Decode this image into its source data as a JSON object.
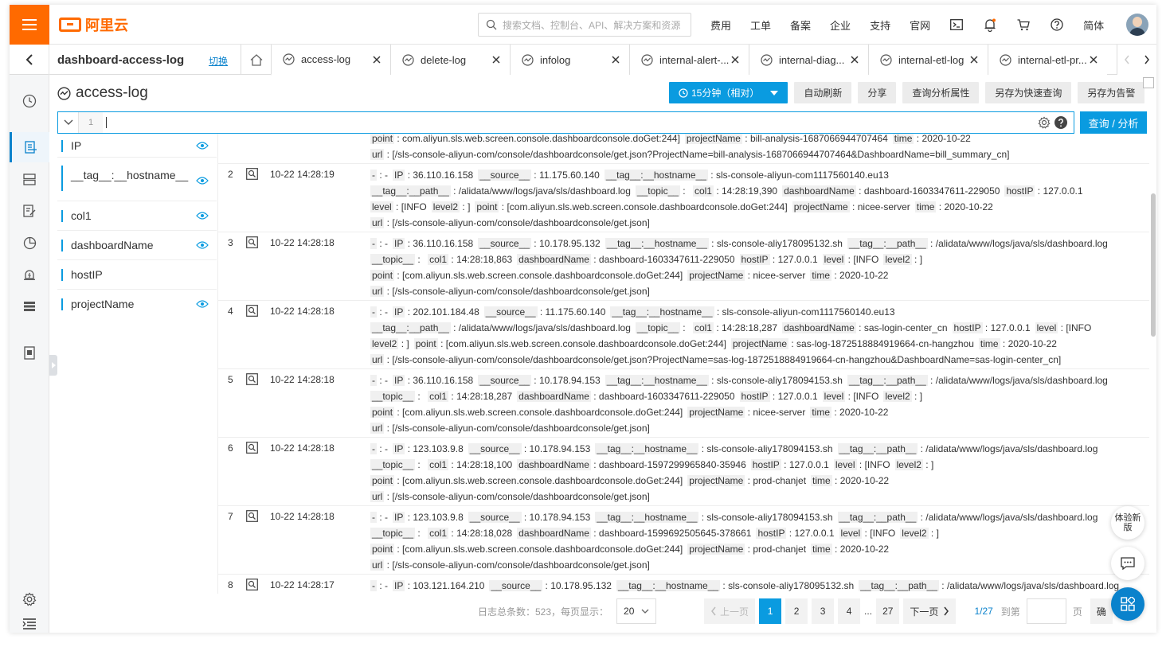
{
  "brand": {
    "name": "阿里云"
  },
  "search": {
    "placeholder": "搜索文档、控制台、API、解决方案和资源"
  },
  "topnav": [
    "费用",
    "工单",
    "备案",
    "企业",
    "支持",
    "官网"
  ],
  "lang": "简体",
  "project": {
    "name": "dashboard-access-log",
    "switch_label": "切换"
  },
  "tabs": [
    {
      "label": "access-log",
      "active": true
    },
    {
      "label": "delete-log"
    },
    {
      "label": "infolog"
    },
    {
      "label": "internal-alert-..."
    },
    {
      "label": "internal-diag..."
    },
    {
      "label": "internal-etl-log"
    },
    {
      "label": "internal-etl-pr..."
    }
  ],
  "query": {
    "title": "access-log",
    "time_label": "15分钟（相对）",
    "buttons": [
      "自动刷新",
      "分享",
      "查询分析属性",
      "另存为快速查询",
      "另存为告警"
    ],
    "line_number": "1",
    "submit_label": "查询 / 分析"
  },
  "fields": [
    "IP",
    "__tag__:__hostname__",
    "col1",
    "dashboardName",
    "hostIP",
    "projectName"
  ],
  "logs": [
    {
      "num": "",
      "time": "",
      "lines": [
        [
          [
            "point",
            "com.aliyun.sls.web.screen.console.dashboardconsole.doGet:244]"
          ],
          [
            "projectName",
            "bill-analysis-1687066944707464"
          ],
          [
            "time",
            "2020-10-22"
          ]
        ],
        [
          [
            "url",
            "[/sls-console-aliyun-com/console/dashboardconsole/get.json?ProjectName=bill-analysis-1687066944707464&DashboardName=bill_summary_cn]"
          ]
        ]
      ]
    },
    {
      "num": "2",
      "time": "10-22 14:28:19",
      "lines": [
        [
          [
            "-",
            "-"
          ],
          [
            "IP",
            "36.110.16.158"
          ],
          [
            "__source__",
            "11.175.60.140"
          ],
          [
            "__tag__:__hostname__",
            "sls-console-aliyun-com1117560140.eu13"
          ]
        ],
        [
          [
            "__tag__:__path__",
            "/alidata/www/logs/java/sls/dashboard.log"
          ],
          [
            "__topic__",
            ""
          ],
          [
            "col1",
            "14:28:19,390"
          ],
          [
            "dashboardName",
            "dashboard-1603347611-229050"
          ],
          [
            "hostIP",
            "127.0.0.1"
          ]
        ],
        [
          [
            "level",
            "[INFO"
          ],
          [
            "level2",
            "]"
          ],
          [
            "point",
            "[com.aliyun.sls.web.screen.console.dashboardconsole.doGet:244]"
          ],
          [
            "projectName",
            "nicee-server"
          ],
          [
            "time",
            "2020-10-22"
          ]
        ],
        [
          [
            "url",
            "[/sls-console-aliyun-com/console/dashboardconsole/get.json]"
          ]
        ]
      ]
    },
    {
      "num": "3",
      "time": "10-22 14:28:18",
      "lines": [
        [
          [
            "-",
            "-"
          ],
          [
            "IP",
            "36.110.16.158"
          ],
          [
            "__source__",
            "10.178.95.132"
          ],
          [
            "__tag__:__hostname__",
            "sls-console-aliy178095132.sh"
          ],
          [
            "__tag__:__path__",
            "/alidata/www/logs/java/sls/dashboard.log"
          ]
        ],
        [
          [
            "__topic__",
            ""
          ],
          [
            "col1",
            "14:28:18,863"
          ],
          [
            "dashboardName",
            "dashboard-1603347611-229050"
          ],
          [
            "hostIP",
            "127.0.0.1"
          ],
          [
            "level",
            "[INFO"
          ],
          [
            "level2",
            "]"
          ]
        ],
        [
          [
            "point",
            "[com.aliyun.sls.web.screen.console.dashboardconsole.doGet:244]"
          ],
          [
            "projectName",
            "nicee-server"
          ],
          [
            "time",
            "2020-10-22"
          ]
        ],
        [
          [
            "url",
            "[/sls-console-aliyun-com/console/dashboardconsole/get.json]"
          ]
        ]
      ]
    },
    {
      "num": "4",
      "time": "10-22 14:28:18",
      "lines": [
        [
          [
            "-",
            "-"
          ],
          [
            "IP",
            "202.101.184.48"
          ],
          [
            "__source__",
            "11.175.60.140"
          ],
          [
            "__tag__:__hostname__",
            "sls-console-aliyun-com1117560140.eu13"
          ]
        ],
        [
          [
            "__tag__:__path__",
            "/alidata/www/logs/java/sls/dashboard.log"
          ],
          [
            "__topic__",
            ""
          ],
          [
            "col1",
            "14:28:18,287"
          ],
          [
            "dashboardName",
            "sas-login-center_cn"
          ],
          [
            "hostIP",
            "127.0.0.1"
          ],
          [
            "level",
            "[INFO"
          ]
        ],
        [
          [
            "level2",
            "]"
          ],
          [
            "point",
            "[com.aliyun.sls.web.screen.console.dashboardconsole.doGet:244]"
          ],
          [
            "projectName",
            "sas-log-1872518884919664-cn-hangzhou"
          ],
          [
            "time",
            "2020-10-22"
          ]
        ],
        [
          [
            "url",
            "[/sls-console-aliyun-com/console/dashboardconsole/get.json?ProjectName=sas-log-1872518884919664-cn-hangzhou&DashboardName=sas-login-center_cn]"
          ]
        ]
      ]
    },
    {
      "num": "5",
      "time": "10-22 14:28:18",
      "lines": [
        [
          [
            "-",
            "-"
          ],
          [
            "IP",
            "36.110.16.158"
          ],
          [
            "__source__",
            "10.178.94.153"
          ],
          [
            "__tag__:__hostname__",
            "sls-console-aliy178094153.sh"
          ],
          [
            "__tag__:__path__",
            "/alidata/www/logs/java/sls/dashboard.log"
          ]
        ],
        [
          [
            "__topic__",
            ""
          ],
          [
            "col1",
            "14:28:18,287"
          ],
          [
            "dashboardName",
            "dashboard-1603347611-229050"
          ],
          [
            "hostIP",
            "127.0.0.1"
          ],
          [
            "level",
            "[INFO"
          ],
          [
            "level2",
            "]"
          ]
        ],
        [
          [
            "point",
            "[com.aliyun.sls.web.screen.console.dashboardconsole.doGet:244]"
          ],
          [
            "projectName",
            "nicee-server"
          ],
          [
            "time",
            "2020-10-22"
          ]
        ],
        [
          [
            "url",
            "[/sls-console-aliyun-com/console/dashboardconsole/get.json]"
          ]
        ]
      ]
    },
    {
      "num": "6",
      "time": "10-22 14:28:18",
      "lines": [
        [
          [
            "-",
            "-"
          ],
          [
            "IP",
            "123.103.9.8"
          ],
          [
            "__source__",
            "10.178.94.153"
          ],
          [
            "__tag__:__hostname__",
            "sls-console-aliy178094153.sh"
          ],
          [
            "__tag__:__path__",
            "/alidata/www/logs/java/sls/dashboard.log"
          ]
        ],
        [
          [
            "__topic__",
            ""
          ],
          [
            "col1",
            "14:28:18,100"
          ],
          [
            "dashboardName",
            "dashboard-1597299965840-35946"
          ],
          [
            "hostIP",
            "127.0.0.1"
          ],
          [
            "level",
            "[INFO"
          ],
          [
            "level2",
            "]"
          ]
        ],
        [
          [
            "point",
            "[com.aliyun.sls.web.screen.console.dashboardconsole.doGet:244]"
          ],
          [
            "projectName",
            "prod-chanjet"
          ],
          [
            "time",
            "2020-10-22"
          ]
        ],
        [
          [
            "url",
            "[/sls-console-aliyun-com/console/dashboardconsole/get.json]"
          ]
        ]
      ]
    },
    {
      "num": "7",
      "time": "10-22 14:28:18",
      "lines": [
        [
          [
            "-",
            "-"
          ],
          [
            "IP",
            "123.103.9.8"
          ],
          [
            "__source__",
            "10.178.94.153"
          ],
          [
            "__tag__:__hostname__",
            "sls-console-aliy178094153.sh"
          ],
          [
            "__tag__:__path__",
            "/alidata/www/logs/java/sls/dashboard.log"
          ]
        ],
        [
          [
            "__topic__",
            ""
          ],
          [
            "col1",
            "14:28:18,028"
          ],
          [
            "dashboardName",
            "dashboard-1599692505645-378661"
          ],
          [
            "hostIP",
            "127.0.0.1"
          ],
          [
            "level",
            "[INFO"
          ],
          [
            "level2",
            "]"
          ]
        ],
        [
          [
            "point",
            "[com.aliyun.sls.web.screen.console.dashboardconsole.doGet:244]"
          ],
          [
            "projectName",
            "prod-chanjet"
          ],
          [
            "time",
            "2020-10-22"
          ]
        ],
        [
          [
            "url",
            "[/sls-console-aliyun-com/console/dashboardconsole/get.json]"
          ]
        ]
      ]
    },
    {
      "num": "8",
      "time": "10-22 14:28:17",
      "lines": [
        [
          [
            "-",
            "-"
          ],
          [
            "IP",
            "103.121.164.210"
          ],
          [
            "__source__",
            "10.178.95.132"
          ],
          [
            "__tag__:__hostname__",
            "sls-console-aliy178095132.sh"
          ],
          [
            "__tag__:__path__",
            "/alidata/www/logs/java/sls/dashboard.log"
          ]
        ]
      ]
    }
  ],
  "pager": {
    "total_label": "日志总条数：523，每页显示：",
    "page_size": "20",
    "prev": "上一页",
    "pages": [
      "1",
      "2",
      "3",
      "4",
      "...",
      "27"
    ],
    "next": "下一页",
    "current": "1/27",
    "goto_label": "到第",
    "page_unit": "页",
    "confirm": "确"
  },
  "floating": {
    "new_version": "体验新版"
  },
  "colors": {
    "brand": "#ff6a00",
    "primary": "#0a9be0",
    "link": "#0a82cc"
  }
}
